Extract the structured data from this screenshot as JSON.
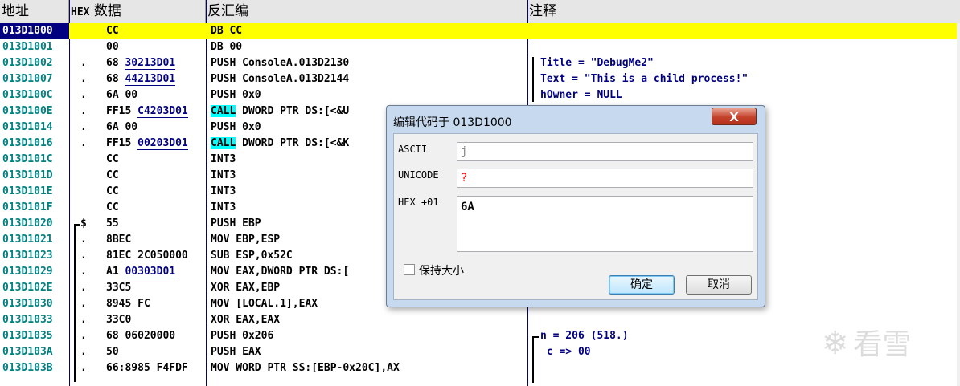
{
  "columns": {
    "address": "地址",
    "hex_prefix": "HEX",
    "hex_suffix": " 数据",
    "disasm": "反汇编",
    "comment": "注释"
  },
  "rows": [
    {
      "addr": "013D1000",
      "mark": "",
      "hex": "CC",
      "asm": "DB CC",
      "cmt": "",
      "selected": true
    },
    {
      "addr": "013D1001",
      "mark": "",
      "hex": "00",
      "asm": "DB 00",
      "cmt": ""
    },
    {
      "addr": "013D1002",
      "mark": ".",
      "hex": "68 ",
      "hex_ul": "30213D01",
      "asm": "PUSH ConsoleA.013D2130",
      "cmt": "Title = \"DebugMe2\""
    },
    {
      "addr": "013D1007",
      "mark": ".",
      "hex": "68 ",
      "hex_ul": "44213D01",
      "asm": "PUSH ConsoleA.013D2144",
      "cmt": "Text = \"This is a child process!\""
    },
    {
      "addr": "013D100C",
      "mark": ".",
      "hex": "6A 00",
      "asm": "PUSH 0x0",
      "cmt": "hOwner = NULL"
    },
    {
      "addr": "013D100E",
      "mark": ".",
      "hex": "FF15 ",
      "hex_ul": "C4203D01",
      "call": "CALL",
      "asm": " DWORD PTR DS:[<&U",
      "cmt": ""
    },
    {
      "addr": "013D1014",
      "mark": ".",
      "hex": "6A 00",
      "asm": "PUSH 0x0",
      "cmt": ""
    },
    {
      "addr": "013D1016",
      "mark": ".",
      "hex": "FF15 ",
      "hex_ul": "00203D01",
      "call": "CALL",
      "asm": " DWORD PTR DS:[<&K",
      "cmt": ""
    },
    {
      "addr": "013D101C",
      "mark": "",
      "hex": "CC",
      "asm": "INT3",
      "cmt": ""
    },
    {
      "addr": "013D101D",
      "mark": "",
      "hex": "CC",
      "asm": "INT3",
      "cmt": ""
    },
    {
      "addr": "013D101E",
      "mark": "",
      "hex": "CC",
      "asm": "INT3",
      "cmt": ""
    },
    {
      "addr": "013D101F",
      "mark": "",
      "hex": "CC",
      "asm": "INT3",
      "cmt": ""
    },
    {
      "addr": "013D1020",
      "mark": "$",
      "hex": "55",
      "asm": "PUSH EBP",
      "cmt": ""
    },
    {
      "addr": "013D1021",
      "mark": ".",
      "hex": "8BEC",
      "asm": "MOV EBP,ESP",
      "cmt": ""
    },
    {
      "addr": "013D1023",
      "mark": ".",
      "hex": "81EC 2C050000",
      "asm": "SUB ESP,0x52C",
      "cmt": ""
    },
    {
      "addr": "013D1029",
      "mark": ".",
      "hex": "A1 ",
      "hex_ul": "00303D01",
      "asm": "MOV EAX,DWORD PTR DS:[",
      "cmt": ""
    },
    {
      "addr": "013D102E",
      "mark": ".",
      "hex": "33C5",
      "asm": "XOR EAX,EBP",
      "cmt": ""
    },
    {
      "addr": "013D1030",
      "mark": ".",
      "hex": "8945 FC",
      "asm": "MOV [LOCAL.1],EAX",
      "cmt": ""
    },
    {
      "addr": "013D1033",
      "mark": ".",
      "hex": "33C0",
      "asm": "XOR EAX,EAX",
      "cmt": ""
    },
    {
      "addr": "013D1035",
      "mark": ".",
      "hex": "68 06020000",
      "asm": "PUSH 0x206",
      "cmt": "n = 206 (518.)"
    },
    {
      "addr": "013D103A",
      "mark": ".",
      "hex": "50",
      "asm": "PUSH EAX",
      "cmt": " c => 00"
    },
    {
      "addr": "013D103B",
      "mark": ".",
      "hex": "66:8985 F4FDF",
      "asm": "MOV WORD PTR SS:[EBP-0x20C],AX",
      "cmt": ""
    }
  ],
  "dialog": {
    "title": "编辑代码于 013D1000",
    "close_label": "X",
    "ascii_label": "ASCII",
    "ascii_value": "j",
    "unicode_label": "UNICODE",
    "unicode_value": "?",
    "hex_label": "HEX +01",
    "hex_value": "6A",
    "keep_size_label": "保持大小",
    "keep_size_checked": false,
    "ok_label": "确定",
    "cancel_label": "取消"
  },
  "watermark": {
    "text": "看雪"
  },
  "colors": {
    "address": "#008080",
    "selected_bg": "#ffff00",
    "call_highlight": "#00ffff",
    "comment": "#000080"
  }
}
